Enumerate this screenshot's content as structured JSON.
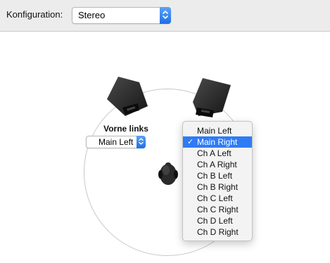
{
  "toolbar": {
    "config_label": "Konfiguration:",
    "config_value": "Stereo"
  },
  "left_channel": {
    "title": "Vorne links",
    "selected": "Main Left"
  },
  "dropdown": {
    "items": [
      {
        "label": "Main Left",
        "selected": false
      },
      {
        "label": "Main Right",
        "selected": true
      },
      {
        "label": "Ch A Left",
        "selected": false
      },
      {
        "label": "Ch A Right",
        "selected": false
      },
      {
        "label": "Ch B Left",
        "selected": false
      },
      {
        "label": "Ch B Right",
        "selected": false
      },
      {
        "label": "Ch C Left",
        "selected": false
      },
      {
        "label": "Ch C Right",
        "selected": false
      },
      {
        "label": "Ch D Left",
        "selected": false
      },
      {
        "label": "Ch D Right",
        "selected": false
      }
    ],
    "check_mark": "✓"
  },
  "colors": {
    "accent": "#2f7bf5",
    "toolbar_bg": "#ececec"
  },
  "icons": {
    "stepper": "up-down-chevron-icon",
    "speaker": "speaker-icon",
    "listener": "listener-head-icon",
    "check": "checkmark-icon"
  }
}
